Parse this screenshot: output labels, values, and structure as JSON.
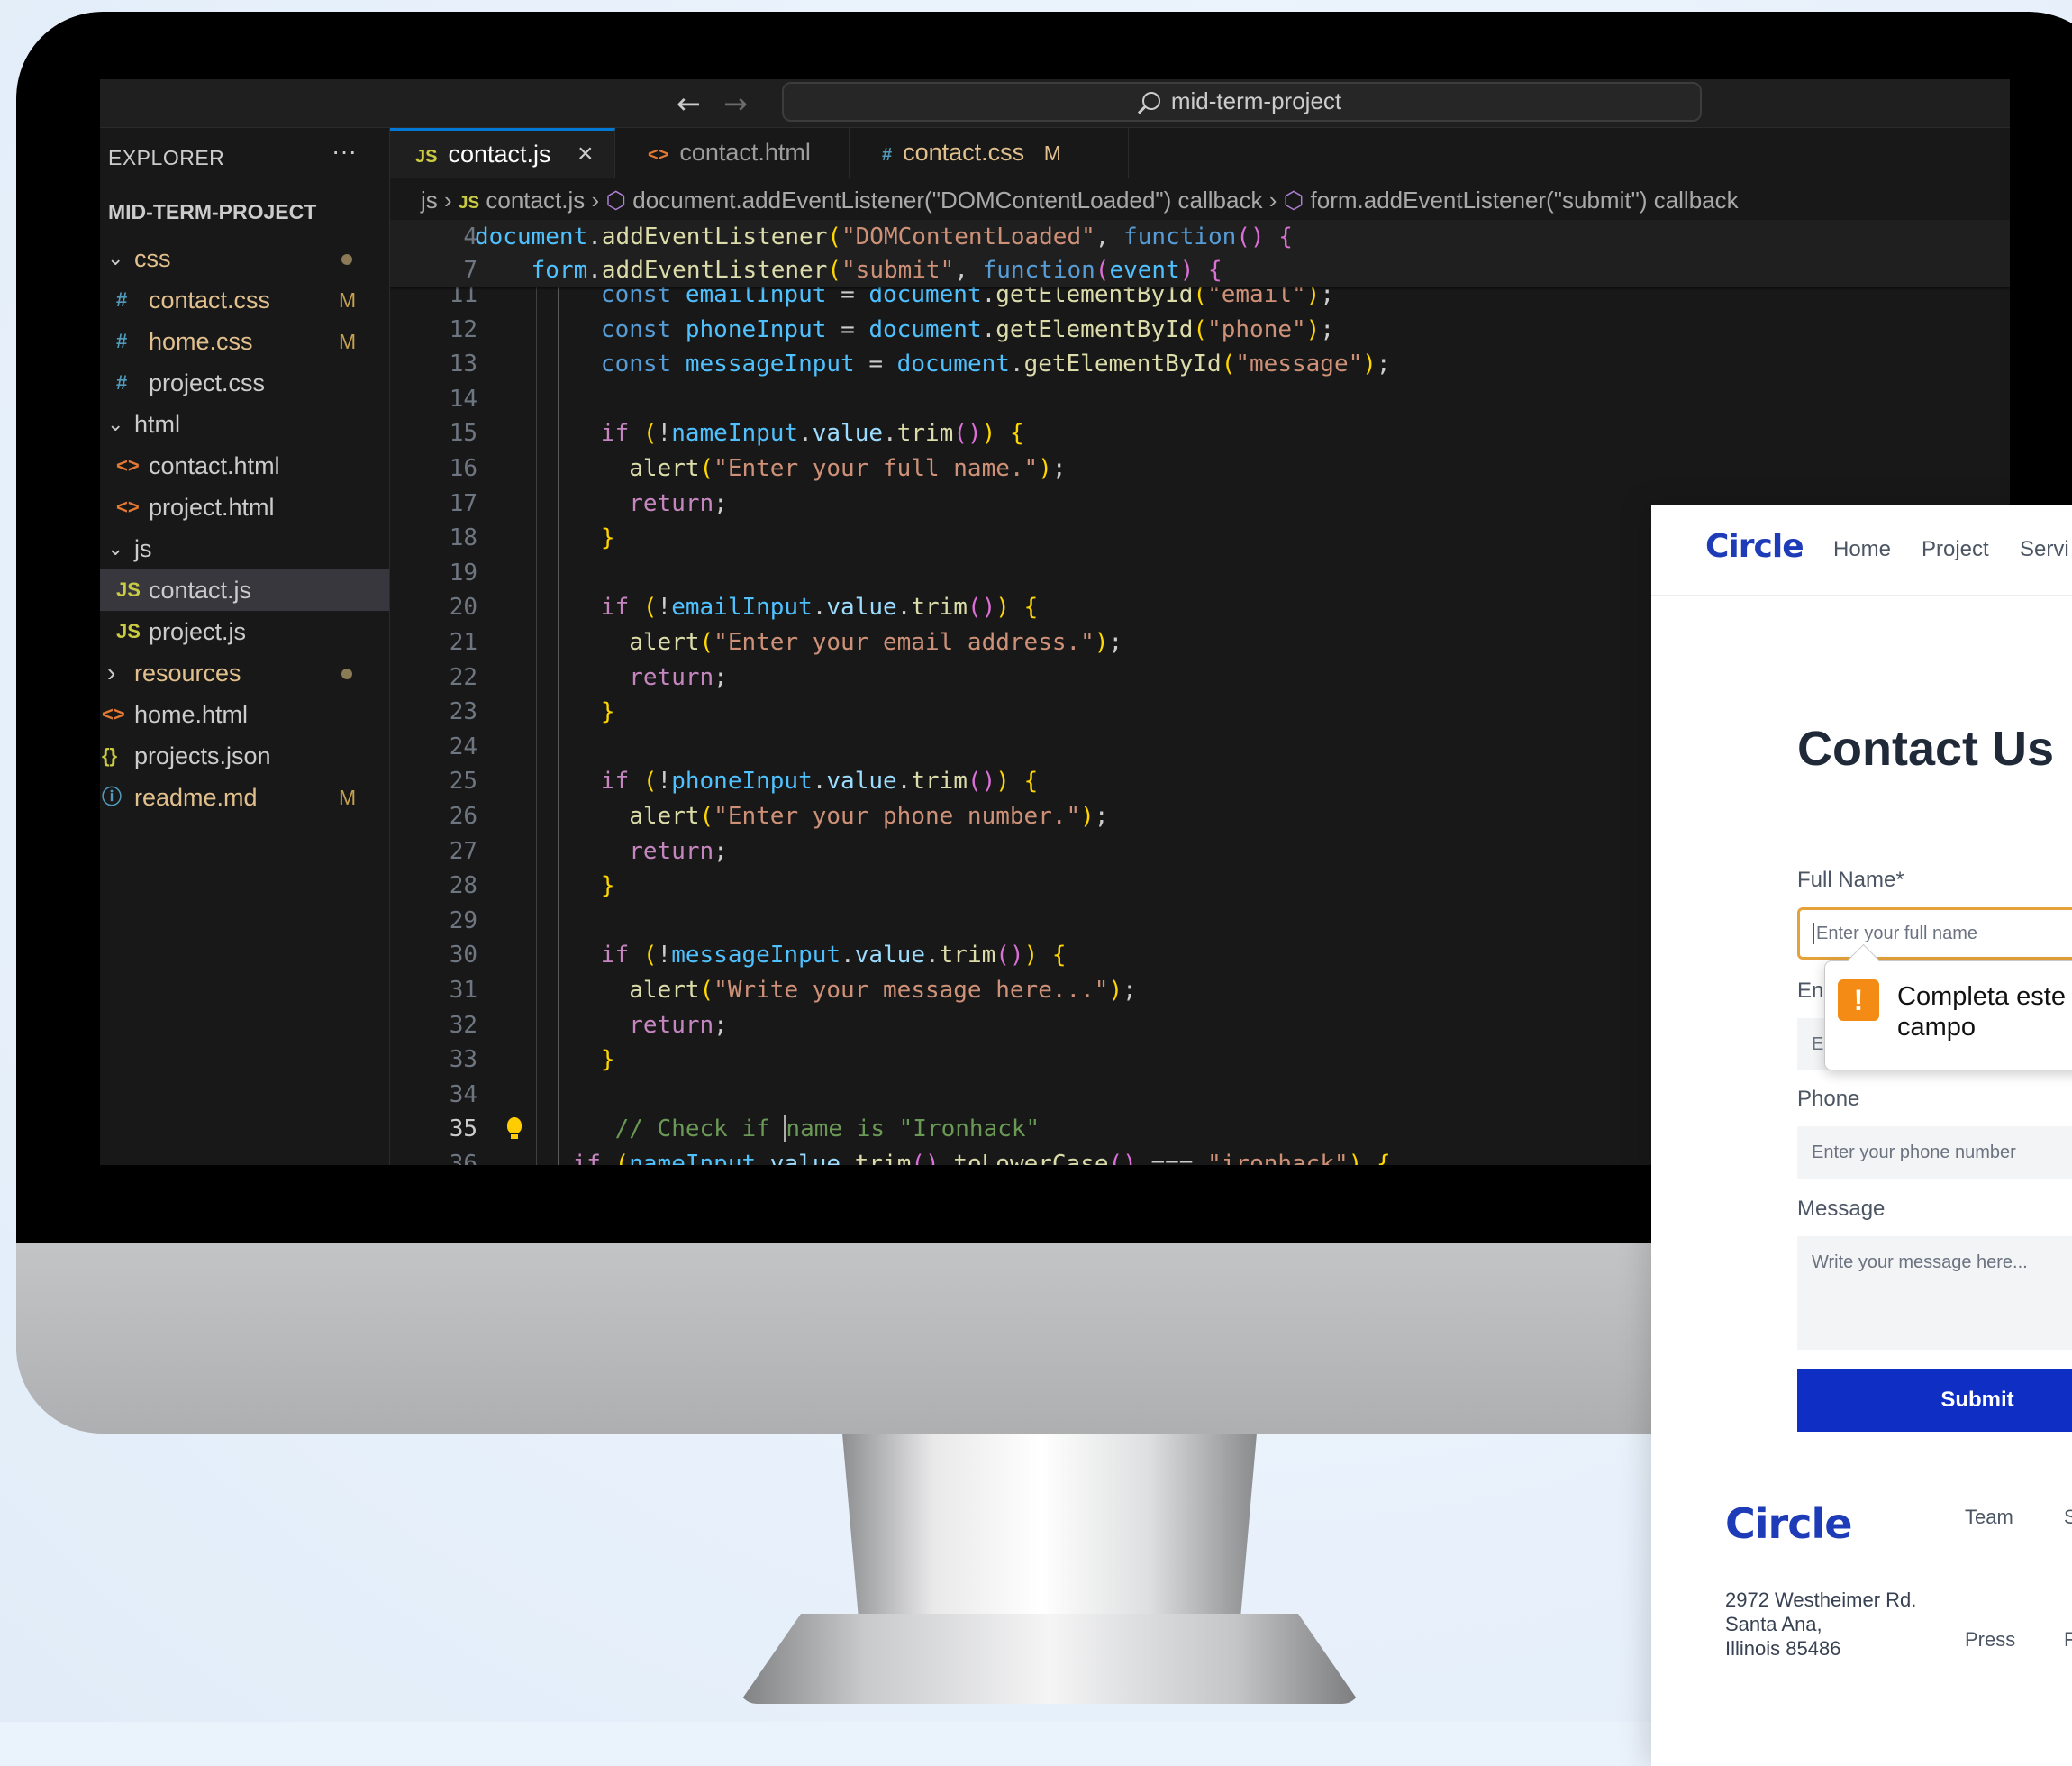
{
  "editor": {
    "command_center": "mid-term-project",
    "explorer_title": "EXPLORER",
    "explorer_more": "···",
    "project_name": "MID-TERM-PROJECT",
    "tree": [
      {
        "type": "folder",
        "label": "css",
        "icon": "chevron-down-icon",
        "color": "#e2c08d",
        "dot": true
      },
      {
        "type": "file",
        "label": "contact.css",
        "icon": "#",
        "iconColor": "#519aba",
        "color": "#e2c08d",
        "badge": "M"
      },
      {
        "type": "file",
        "label": "home.css",
        "icon": "#",
        "iconColor": "#519aba",
        "color": "#e2c08d",
        "badge": "M"
      },
      {
        "type": "file",
        "label": "project.css",
        "icon": "#",
        "iconColor": "#519aba",
        "color": "#cccccc"
      },
      {
        "type": "folder",
        "label": "html",
        "icon": "chevron-down-icon",
        "color": "#cccccc"
      },
      {
        "type": "file",
        "label": "contact.html",
        "icon": "<>",
        "iconColor": "#e37933",
        "color": "#cccccc"
      },
      {
        "type": "file",
        "label": "project.html",
        "icon": "<>",
        "iconColor": "#e37933",
        "color": "#cccccc"
      },
      {
        "type": "folder",
        "label": "js",
        "icon": "chevron-down-icon",
        "color": "#cccccc"
      },
      {
        "type": "file",
        "label": "contact.js",
        "icon": "JS",
        "iconColor": "#cbcb41",
        "color": "#cccccc",
        "selected": true
      },
      {
        "type": "file",
        "label": "project.js",
        "icon": "JS",
        "iconColor": "#cbcb41",
        "color": "#cccccc"
      },
      {
        "type": "folder",
        "label": "resources",
        "icon": "chevron-right-icon",
        "color": "#e2c08d",
        "dot": true
      },
      {
        "type": "root",
        "label": "home.html",
        "icon": "<>",
        "iconColor": "#e37933",
        "color": "#cccccc"
      },
      {
        "type": "root",
        "label": "projects.json",
        "icon": "{}",
        "iconColor": "#cbcb41",
        "color": "#cccccc"
      },
      {
        "type": "root",
        "label": "readme.md",
        "icon": "ⓘ",
        "iconColor": "#519aba",
        "color": "#e2c08d",
        "badge": "M"
      }
    ],
    "tabs": [
      {
        "icon": "JS",
        "label": "contact.js",
        "close": "×",
        "active": true
      },
      {
        "icon": "<>",
        "label": "contact.html"
      },
      {
        "icon": "#",
        "label": "contact.css",
        "badge": "M"
      }
    ],
    "breadcrumbs": {
      "folder": "js",
      "file": "contact.js",
      "symbol1": "document.addEventListener(\"DOMContentLoaded\") callback",
      "symbol2": "form.addEventListener(\"submit\") callback"
    },
    "sticky_lines": [
      {
        "n": "4",
        "t": "document.addEventListener(\"DOMContentLoaded\", function() {"
      },
      {
        "n": "7",
        "t": "    form.addEventListener(\"submit\", function(event) {"
      }
    ],
    "code_lines": [
      {
        "n": "11",
        "t": "      const emailInput = document.getElementById(\"email\");"
      },
      {
        "n": "12",
        "t": "      const phoneInput = document.getElementById(\"phone\");"
      },
      {
        "n": "13",
        "t": "      const messageInput = document.getElementById(\"message\");"
      },
      {
        "n": "14",
        "t": ""
      },
      {
        "n": "15",
        "t": "      if (!nameInput.value.trim()) {"
      },
      {
        "n": "16",
        "t": "        alert(\"Enter your full name.\");"
      },
      {
        "n": "17",
        "t": "        return;"
      },
      {
        "n": "18",
        "t": "      }"
      },
      {
        "n": "19",
        "t": ""
      },
      {
        "n": "20",
        "t": "      if (!emailInput.value.trim()) {"
      },
      {
        "n": "21",
        "t": "        alert(\"Enter your email address.\");"
      },
      {
        "n": "22",
        "t": "        return;"
      },
      {
        "n": "23",
        "t": "      }"
      },
      {
        "n": "24",
        "t": ""
      },
      {
        "n": "25",
        "t": "      if (!phoneInput.value.trim()) {"
      },
      {
        "n": "26",
        "t": "        alert(\"Enter your phone number.\");"
      },
      {
        "n": "27",
        "t": "        return;"
      },
      {
        "n": "28",
        "t": "      }"
      },
      {
        "n": "29",
        "t": ""
      },
      {
        "n": "30",
        "t": "      if (!messageInput.value.trim()) {"
      },
      {
        "n": "31",
        "t": "        alert(\"Write your message here...\");"
      },
      {
        "n": "32",
        "t": "        return;"
      },
      {
        "n": "33",
        "t": "      }"
      },
      {
        "n": "34",
        "t": ""
      },
      {
        "n": "35",
        "t": "       // Check if name is \"Ironhack\""
      },
      {
        "n": "36",
        "t": "    if (nameInput.value.trim().toLowerCase() === \"ironhack\") {"
      }
    ],
    "current_line": "35"
  },
  "website": {
    "logo": "Circle",
    "nav": [
      "Home",
      "Project",
      "Servi"
    ],
    "title": "Contact Us",
    "fields": [
      {
        "label": "Full Name*",
        "placeholder": "Enter your full name",
        "focused": true
      },
      {
        "label": "En",
        "placeholder": "E"
      },
      {
        "label": "Phone",
        "placeholder": "Enter your phone number"
      },
      {
        "label": "Message",
        "placeholder": "Write your message here..."
      }
    ],
    "tooltip": {
      "icon": "!",
      "text": "Completa este campo"
    },
    "submit": "Submit",
    "footer": {
      "logo": "Circle",
      "links": [
        "Team",
        "S",
        "Press",
        "F"
      ],
      "address": [
        "2972 Westheimer Rd.",
        "Santa Ana,",
        "Illinois 85486"
      ]
    }
  }
}
